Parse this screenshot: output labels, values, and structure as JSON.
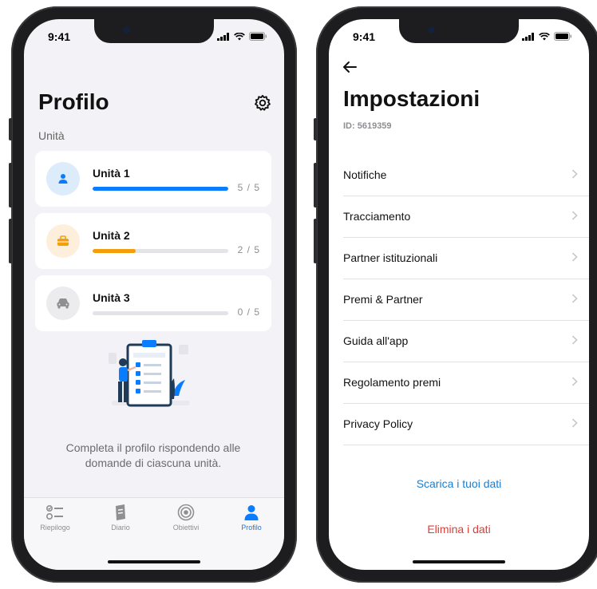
{
  "status_bar": {
    "time": "9:41"
  },
  "profile_screen": {
    "title": "Profilo",
    "section_label": "Unità",
    "units": [
      {
        "name": "Unità 1",
        "count": "5 / 5",
        "progress": 1.0,
        "color": "#0a7cff",
        "icon_bg": "#dcecfb",
        "icon": "person-icon"
      },
      {
        "name": "Unità 2",
        "count": "2 / 5",
        "progress": 0.4,
        "color": "#f59e0b",
        "icon_bg": "#fdefdc",
        "icon": "briefcase-icon"
      },
      {
        "name": "Unità 3",
        "count": "0 / 5",
        "progress": 0.0,
        "color": "#0a7cff",
        "icon_bg": "#ececef",
        "icon": "car-icon"
      }
    ],
    "hint": "Completa il profilo rispondendo alle domande di ciascuna unità.",
    "tabs": [
      {
        "label": "Riepilogo",
        "icon": "checklist-icon"
      },
      {
        "label": "Diario",
        "icon": "journal-icon"
      },
      {
        "label": "Obiettivi",
        "icon": "target-icon"
      },
      {
        "label": "Profilo",
        "icon": "person-icon",
        "active": true
      }
    ]
  },
  "settings_screen": {
    "title": "Impostazioni",
    "user_id": "ID: 5619359",
    "items": [
      {
        "label": "Notifiche"
      },
      {
        "label": "Tracciamento"
      },
      {
        "label": "Partner istituzionali"
      },
      {
        "label": "Premi & Partner"
      },
      {
        "label": "Guida all'app"
      },
      {
        "label": "Regolamento premi"
      },
      {
        "label": "Privacy Policy"
      }
    ],
    "download_link": "Scarica i tuoi dati",
    "delete_link": "Elimina i dati"
  },
  "colors": {
    "accent": "#0a7cff",
    "link_blue": "#1a7fd1",
    "danger": "#e23b35",
    "warning": "#f59e0b"
  }
}
